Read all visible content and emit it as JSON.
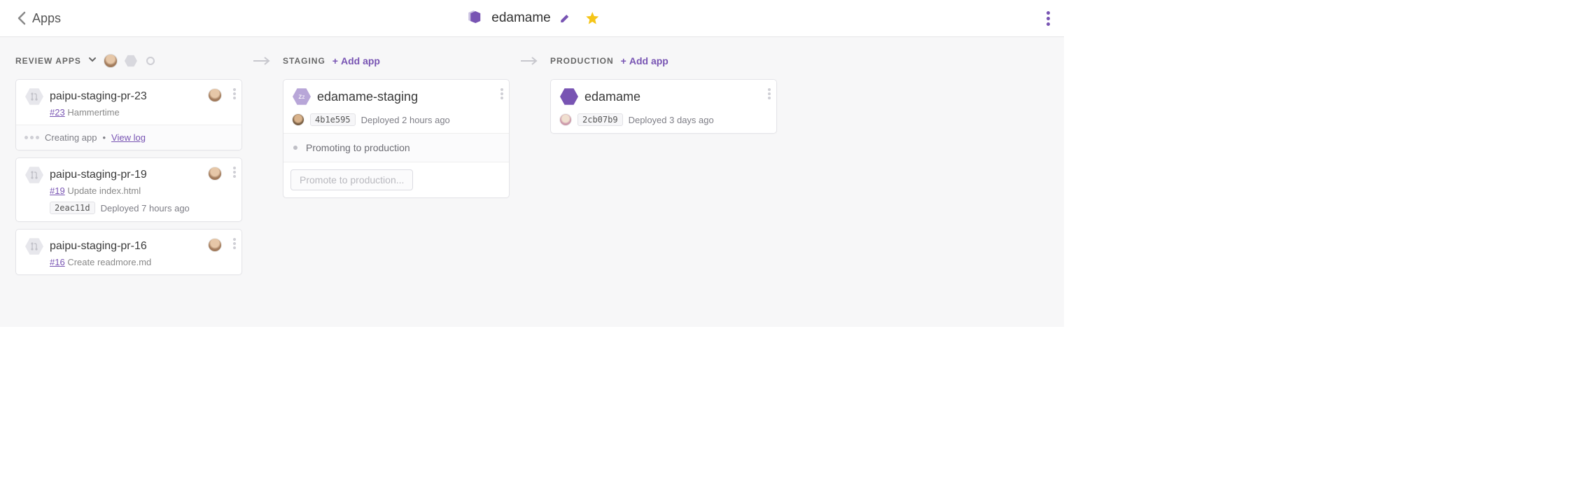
{
  "header": {
    "back_label": "Apps",
    "title": "edamame"
  },
  "columns": {
    "review": {
      "title": "REVIEW APPS",
      "cards": [
        {
          "name": "paipu-staging-pr-23",
          "pr": "#23",
          "pr_title": "Hammertime",
          "footer_status": "Creating app",
          "footer_link": "View log"
        },
        {
          "name": "paipu-staging-pr-19",
          "pr": "#19",
          "pr_title": "Update index.html",
          "sha": "2eac11d",
          "deployed": "Deployed 7 hours ago"
        },
        {
          "name": "paipu-staging-pr-16",
          "pr": "#16",
          "pr_title": "Create readmore.md"
        }
      ]
    },
    "staging": {
      "title": "STAGING",
      "add_label": "Add app",
      "card": {
        "name": "edamame-staging",
        "sha": "4b1e595",
        "deployed": "Deployed 2 hours ago",
        "promoting": "Promoting to production",
        "button": "Promote to production..."
      }
    },
    "production": {
      "title": "PRODUCTION",
      "add_label": "Add app",
      "card": {
        "name": "edamame",
        "sha": "2cb07b9",
        "deployed": "Deployed 3 days ago"
      }
    }
  }
}
